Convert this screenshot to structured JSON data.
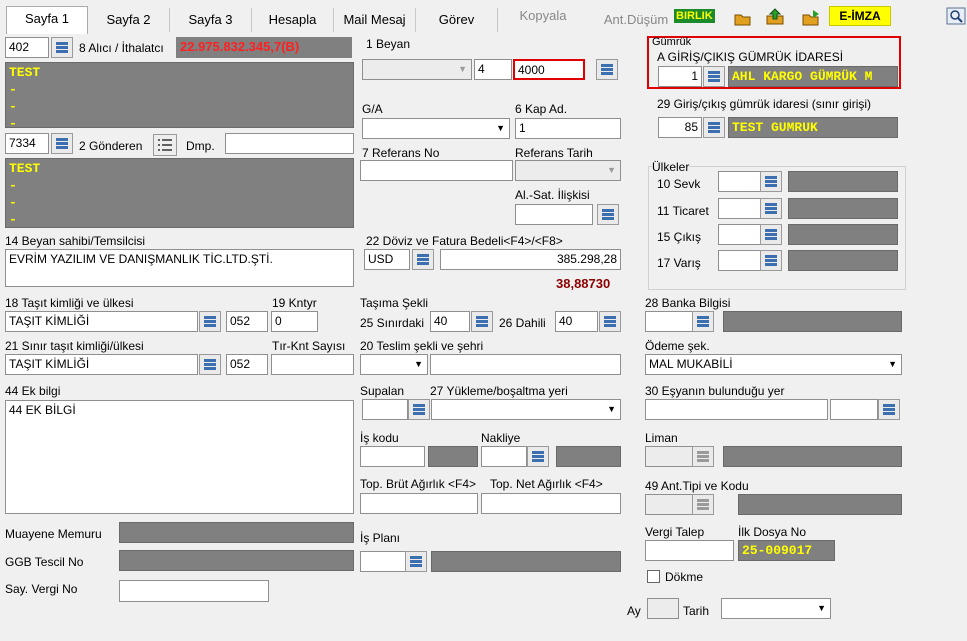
{
  "tabs": [
    {
      "label": "Sayfa 1",
      "active": true
    },
    {
      "label": "Sayfa 2"
    },
    {
      "label": "Sayfa 3"
    },
    {
      "label": "Hesapla"
    },
    {
      "label": "Mail Mesaj"
    },
    {
      "label": "Görev"
    },
    {
      "label": "Kopyala",
      "disabled": true
    },
    {
      "label": "Ant.Düşüm",
      "disabled": true
    }
  ],
  "toolbar": {
    "birlik": "BIRLIK",
    "eimza": "E-İMZA"
  },
  "alici": {
    "code": "402",
    "label": "8 Alıcı / İthalatcı",
    "amount": "22.975.832.345,7(B)",
    "name": "TEST",
    "lines": [
      "-",
      "-",
      "-"
    ]
  },
  "gonderen": {
    "code": "7334",
    "label": "2 Gönderen",
    "dmp_label": "Dmp.",
    "name": "TEST",
    "lines": [
      "-",
      "-",
      "-"
    ]
  },
  "beyan": {
    "label": "1 Beyan",
    "v1": "4",
    "v2": "4000"
  },
  "ga_label": "G/A",
  "kap": {
    "label": "6 Kap Ad.",
    "value": "1"
  },
  "referans": {
    "no_label": "7 Referans No",
    "tarih_label": "Referans Tarih"
  },
  "alsat_label": "Al.-Sat. İlişkisi",
  "gumruk": {
    "label": "Gümrük",
    "idare": "A GİRİŞ/ÇIKIŞ GÜMRÜK İDARESİ",
    "code": "1",
    "name": "AHL KARGO GÜMRÜK M"
  },
  "sinir": {
    "label": "29 Giriş/çıkış gümrük idaresi (sınır girişi)",
    "code": "85",
    "name": "TEST GUMRUK"
  },
  "ulkeler": {
    "label": "Ülkeler",
    "sevk": "10 Sevk",
    "ticaret": "11 Ticaret",
    "cikis": "15 Çıkış",
    "varis": "17 Varış"
  },
  "beyan_sahibi": {
    "label": "14 Beyan sahibi/Temsilcisi",
    "value": "EVRİM YAZILIM VE DANIŞMANLIK TİC.LTD.ŞTİ."
  },
  "doviz": {
    "label": "22 Döviz ve Fatura Bedeli<F4>/<F8>",
    "currency": "USD",
    "amount": "385.298,28",
    "rate": "38,88730"
  },
  "tasit": {
    "label": "18 Taşıt kimliği ve ülkesi",
    "value": "TAŞIT KİMLİĞİ",
    "country": "052",
    "kntyr_label": "19 Kntyr",
    "kntyr": "0"
  },
  "sinir_tasit": {
    "label": "21 Sınır taşıt kimliği/ülkesi",
    "value": "TAŞIT KİMLİĞİ",
    "country": "052",
    "sayisi_label": "Tır-Knt Sayısı"
  },
  "tasima": {
    "label": "Taşıma Şekli",
    "sinir_label": "25 Sınırdaki",
    "sinir": "40",
    "dahili_label": "26 Dahili",
    "dahili": "40"
  },
  "teslim_label": "20 Teslim şekli ve şehri",
  "banka_label": "28 Banka Bilgisi",
  "odeme": {
    "label": "Ödeme şek.",
    "value": "MAL MUKABİLİ"
  },
  "ek_bilgi": {
    "label": "44 Ek bilgi",
    "value": "44 EK BİLGİ"
  },
  "supalan_label": "Supalan",
  "yukleme_label": "27 Yükleme/boşaltma yeri",
  "esya_label": "30 Eşyanın bulunduğu yer",
  "is_kodu_label": "İş kodu",
  "nakliye_label": "Nakliye",
  "liman_label": "Liman",
  "agirlik": {
    "brut": "Top. Brüt Ağırlık <F4>",
    "net": "Top. Net Ağırlık <F4>"
  },
  "ant_label": "49 Ant.Tipi ve Kodu",
  "muayene_label": "Muayene Memuru",
  "ggb_label": "GGB Tescil No",
  "say_vergi_label": "Say. Vergi No",
  "is_plani_label": "İş Planı",
  "vergi_talep_label": "Vergi Talep",
  "ilk_dosya": {
    "label": "İlk Dosya No",
    "value": "25-009017"
  },
  "dokme_label": "Dökme",
  "ay_label": "Ay",
  "tarih_label": "Tarih",
  "colors": {
    "gray": "#808080",
    "yellow": "#ffff00",
    "red": "#e00000",
    "accent": "#3b6fb0"
  }
}
